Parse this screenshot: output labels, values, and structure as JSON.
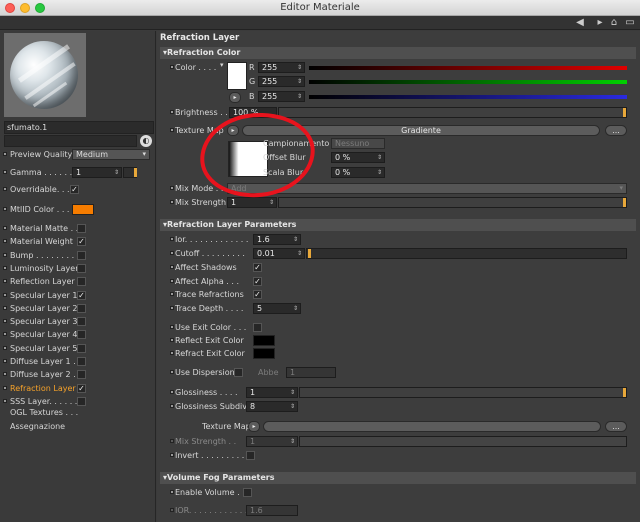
{
  "window": {
    "title": "Editor Materiale"
  },
  "left": {
    "material_name": "sfumato.1",
    "preview_quality_label": "Preview Quality",
    "preview_quality_value": "Medium",
    "gamma_label": "Gamma . . . . . .",
    "gamma_value": "1",
    "overridable_label": "Overridable. . .",
    "mtlid_label": "MtlID Color . . .",
    "mtlid_color": "#f57c00",
    "channels": [
      {
        "label": "Material Matte . .",
        "checked": false
      },
      {
        "label": "Material Weight",
        "checked": true
      },
      {
        "label": "Bump . . . . . . . . . .",
        "checked": false
      },
      {
        "label": "Luminosity Layer",
        "checked": false
      },
      {
        "label": "Reflection Layer",
        "checked": false
      },
      {
        "label": "Specular Layer 1",
        "checked": true
      },
      {
        "label": "Specular Layer 2",
        "checked": false
      },
      {
        "label": "Specular Layer 3",
        "checked": false
      },
      {
        "label": "Specular Layer 4",
        "checked": false
      },
      {
        "label": "Specular Layer 5",
        "checked": false
      },
      {
        "label": "Diffuse Layer 1 . .",
        "checked": false
      },
      {
        "label": "Diffuse Layer 2 . .",
        "checked": false
      },
      {
        "label": "Refraction Layer",
        "checked": true,
        "active": true
      },
      {
        "label": "SSS Layer. . . . . . .",
        "checked": false
      }
    ],
    "ogl_textures": "OGL Textures . . .",
    "assegnazione": "Assegnazione"
  },
  "main": {
    "panel_title": "Refraction Layer",
    "refraction_color": {
      "header": "▾Refraction Color",
      "color_label": "Color . . . .",
      "r_label": "R",
      "r_value": "255",
      "g_label": "G",
      "g_value": "255",
      "b_label": "B",
      "b_value": "255",
      "brightness_label": "Brightness . .",
      "brightness_value": "100 %",
      "texture_map_label": "Texture Map",
      "texture_name": "Gradiente",
      "more_button": "...",
      "campionamento_label": "Campionamento",
      "campionamento_value": "Nessuno",
      "offset_blur_label": "Offset Blur",
      "offset_blur_value": "0 %",
      "scala_blur_label": "Scala Blur",
      "scala_blur_value": "0 %",
      "mix_mode_label": "Mix Mode . . . . . .",
      "mix_mode_value": "Add",
      "mix_strength_label": "Mix Strength",
      "mix_strength_value": "1"
    },
    "refraction_params": {
      "header": "▾Refraction Layer Parameters",
      "ior_label": "Ior. . . . . . . . . . . . .",
      "ior_value": "1.6",
      "cutoff_label": "Cutoff . . . . . . . . .",
      "cutoff_value": "0.01",
      "affect_shadows_label": "Affect Shadows",
      "affect_alpha_label": "Affect Alpha . . .",
      "trace_refractions_label": "Trace Refractions",
      "trace_depth_label": "Trace Depth . . . .",
      "trace_depth_value": "5",
      "use_exit_color_label": "Use Exit Color . . .",
      "reflect_exit_color_label": "Reflect Exit Color",
      "refract_exit_color_label": "Refract Exit Color",
      "use_dispersion_label": "Use Dispersion",
      "abbe_label": "Abbe",
      "abbe_value": "1",
      "glossiness_label": "Glossiness . . . .",
      "glossiness_value": "1",
      "glossiness_subdivs_label": "Glossiness Subdivs",
      "glossiness_subdivs_value": "8",
      "texture_map_label": "Texture Map",
      "more_button": "...",
      "mix_strength_label": "Mix Strength . .",
      "mix_strength_value": "1",
      "invert_label": "Invert . . . . . . . . ."
    },
    "volume_fog": {
      "header": "▾Volume Fog Parameters",
      "enable_volume_label": "Enable Volume . .",
      "ior_label": "IOR. . . . . . . . . . . .",
      "ior_value": "1.6"
    }
  },
  "colors": {
    "accent": "#f6a22a",
    "annotation": "#e8131d"
  }
}
